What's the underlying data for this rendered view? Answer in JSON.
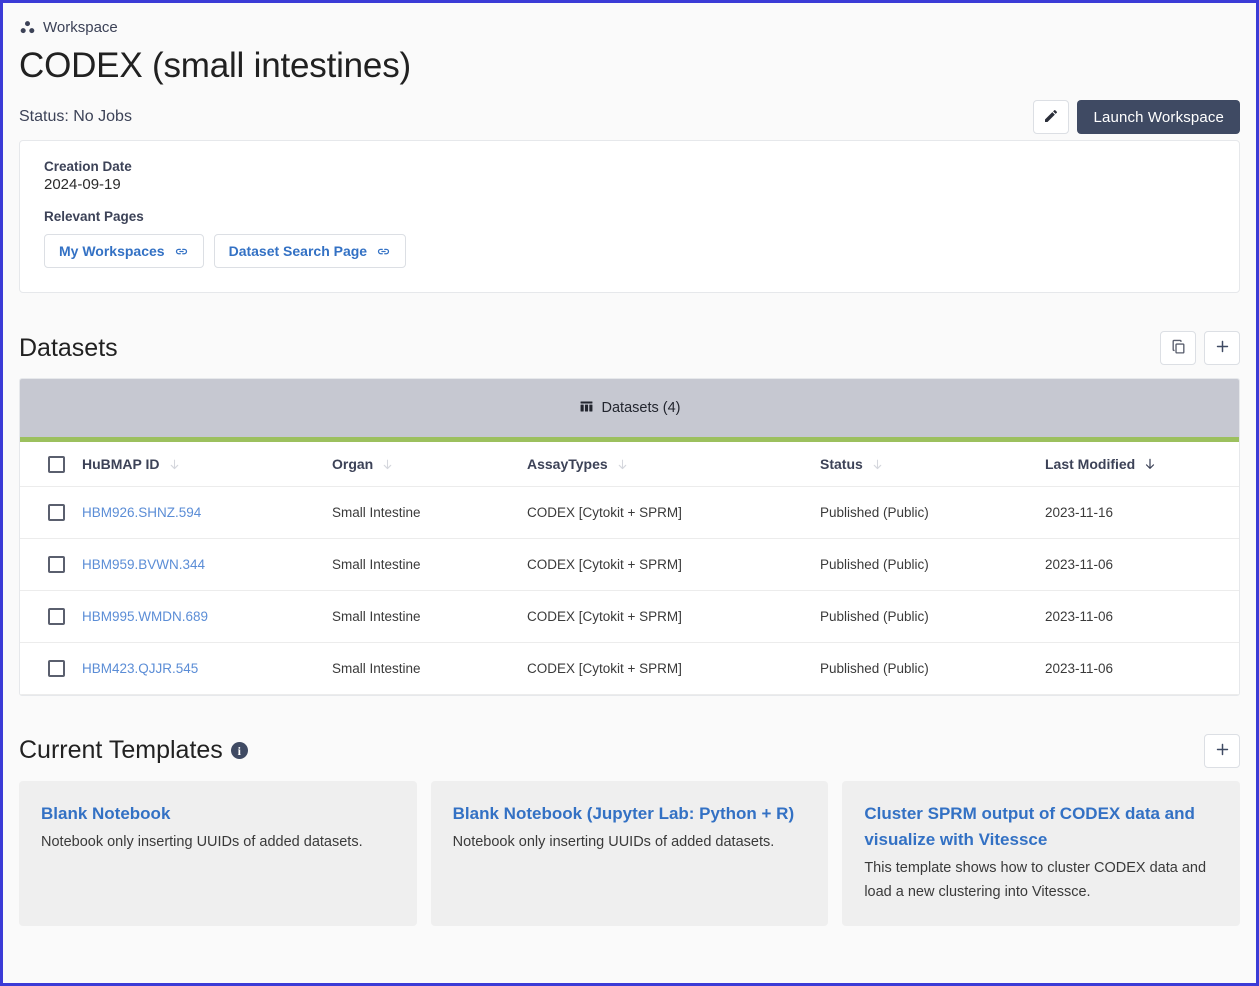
{
  "breadcrumb": {
    "label": "Workspace",
    "icon": "workspace-dots-icon"
  },
  "header": {
    "title": "CODEX (small intestines)",
    "status": "Status: No Jobs",
    "edit_icon": "pencil-icon",
    "launch_label": "Launch Workspace"
  },
  "info": {
    "creation_date_label": "Creation Date",
    "creation_date_value": "2024-09-19",
    "relevant_pages_label": "Relevant Pages",
    "links": [
      {
        "label": "My Workspaces",
        "icon": "link-icon"
      },
      {
        "label": "Dataset Search Page",
        "icon": "link-icon"
      }
    ]
  },
  "datasets": {
    "section_title": "Datasets",
    "copy_icon": "copy-icon",
    "add_icon": "plus-icon",
    "tab_label": "Datasets (4)",
    "tab_icon": "table-icon",
    "accent_color": "#9cc05e",
    "tabbar_color": "#c6c8d1",
    "columns": [
      {
        "label": "HuBMAP ID",
        "sorted": false
      },
      {
        "label": "Organ",
        "sorted": false
      },
      {
        "label": "AssayTypes",
        "sorted": false
      },
      {
        "label": "Status",
        "sorted": false
      },
      {
        "label": "Last Modified",
        "sorted": true
      }
    ],
    "rows": [
      {
        "id": "HBM926.SHNZ.594",
        "organ": "Small Intestine",
        "assay": "CODEX [Cytokit + SPRM]",
        "status": "Published (Public)",
        "modified": "2023-11-16",
        "checked": false
      },
      {
        "id": "HBM959.BVWN.344",
        "organ": "Small Intestine",
        "assay": "CODEX [Cytokit + SPRM]",
        "status": "Published (Public)",
        "modified": "2023-11-06",
        "checked": false
      },
      {
        "id": "HBM995.WMDN.689",
        "organ": "Small Intestine",
        "assay": "CODEX [Cytokit + SPRM]",
        "status": "Published (Public)",
        "modified": "2023-11-06",
        "checked": false
      },
      {
        "id": "HBM423.QJJR.545",
        "organ": "Small Intestine",
        "assay": "CODEX [Cytokit + SPRM]",
        "status": "Published (Public)",
        "modified": "2023-11-06",
        "checked": false
      }
    ]
  },
  "templates": {
    "section_title": "Current Templates",
    "info_icon": "info-icon",
    "info_glyph": "i",
    "add_icon": "plus-icon",
    "cards": [
      {
        "title": "Blank Notebook",
        "description": "Notebook only inserting UUIDs of added datasets."
      },
      {
        "title": "Blank Notebook (Jupyter Lab: Python + R)",
        "description": "Notebook only inserting UUIDs of added datasets."
      },
      {
        "title": "Cluster SPRM output of CODEX data and visualize with Vitessce",
        "description": "This template shows how to cluster CODEX data and load a new clustering into Vitessce."
      }
    ]
  }
}
